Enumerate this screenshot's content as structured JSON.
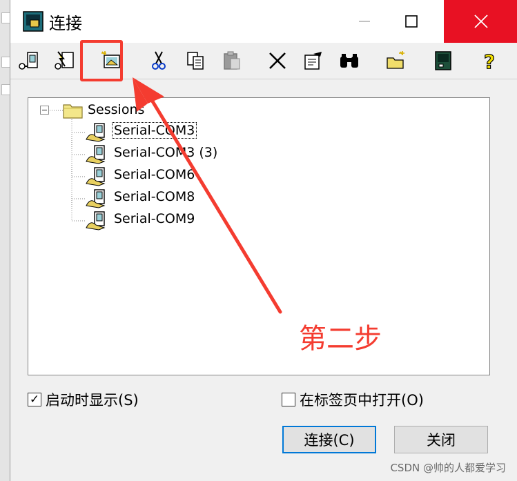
{
  "window": {
    "title": "连接"
  },
  "title_controls": {
    "minimize": "—",
    "maximize": "□",
    "close": "✕"
  },
  "toolbar": [
    {
      "name": "connect-icon"
    },
    {
      "name": "quick-connect-icon"
    },
    {
      "name": "new-session-icon"
    },
    {
      "name": "cut-icon"
    },
    {
      "name": "copy-icon"
    },
    {
      "name": "paste-icon"
    },
    {
      "name": "delete-icon"
    },
    {
      "name": "properties-icon"
    },
    {
      "name": "find-icon"
    },
    {
      "name": "new-folder-icon"
    },
    {
      "name": "terminal-icon"
    },
    {
      "name": "help-icon"
    }
  ],
  "tree": {
    "root": "Sessions",
    "items": [
      "Serial-COM3",
      "Serial-COM3 (3)",
      "Serial-COM6",
      "Serial-COM8",
      "Serial-COM9"
    ],
    "selected_index": 0
  },
  "options": {
    "show_on_startup": {
      "label": "启动时显示(S)",
      "checked": true,
      "mark": "✓"
    },
    "open_in_tab": {
      "label": "在标签页中打开(O)",
      "checked": false
    }
  },
  "buttons": {
    "connect": "连接(C)",
    "close": "关闭"
  },
  "annotation": {
    "text": "第二步",
    "color": "#f43c30"
  },
  "watermark": "CSDN @帅的人都爱学习",
  "colors": {
    "close_button": "#e81123",
    "accent": "#0078d7",
    "annotation": "#f43c30"
  }
}
